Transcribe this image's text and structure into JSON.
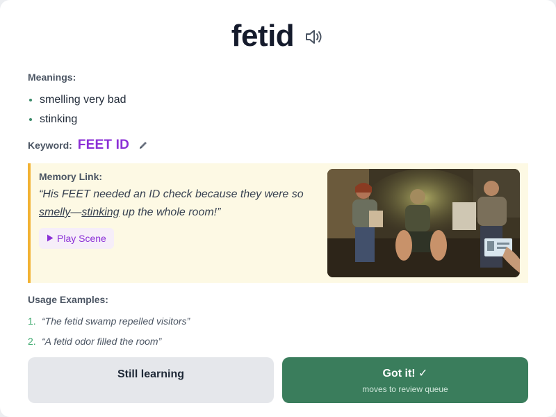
{
  "word": "fetid",
  "icons": {
    "speaker": "speaker-icon",
    "edit": "pencil-icon",
    "play": "play-icon",
    "check": "check-icon"
  },
  "meanings": {
    "label": "Meanings:",
    "items": [
      "smelling very bad",
      "stinking"
    ]
  },
  "keyword": {
    "label": "Keyword:",
    "value": "FEET ID"
  },
  "memory_link": {
    "label": "Memory Link:",
    "quote_open": "“His FEET needed an ID check because they were so ",
    "underlined_1": "smelly",
    "dash": "—",
    "underlined_2": "stinking",
    "quote_close": " up the whole room!”",
    "play_label": "Play Scene",
    "image": "scene-image"
  },
  "usage": {
    "label": "Usage Examples:",
    "examples": [
      {
        "num": "1.",
        "text": "“The fetid swamp repelled visitors”"
      },
      {
        "num": "2.",
        "text": "“A fetid odor filled the room”"
      }
    ]
  },
  "actions": {
    "still_learning": "Still learning",
    "got_it": "Got it! ✓",
    "got_it_sub": "moves to review queue"
  },
  "colors": {
    "keyword": "#8b2fd6",
    "memory_bg": "#fdf9e4",
    "memory_border": "#f2b233",
    "got_it_bg": "#3a7d5c",
    "still_learning_bg": "#e5e7eb"
  }
}
